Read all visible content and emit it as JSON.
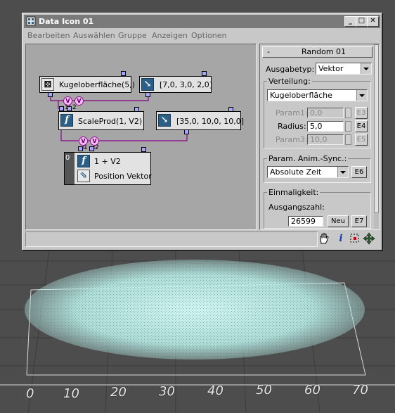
{
  "window": {
    "title": "Data Icon 01"
  },
  "menu": [
    "Bearbeiten",
    "Auswählen",
    "Gruppe",
    "Anzeigen",
    "Optionen"
  ],
  "nodes": {
    "kugel": {
      "label": "Kugeloberfläche(5,)"
    },
    "vec1": {
      "label": "[7,0, 3,0, 2,0]"
    },
    "scale": {
      "label": "ScaleProd(1, V2)"
    },
    "vec2": {
      "label": "[35,0, 10,0, 10,0]"
    },
    "out": {
      "label1": "1 + V2",
      "label2": "Position Vektor",
      "index": "0"
    },
    "ports": {
      "v": "V",
      "p1": "1",
      "p2": "2"
    }
  },
  "panel": {
    "rollout_collapse": "-",
    "rollout_title": "Random 01",
    "ausgabetyp_label": "Ausgabetyp:",
    "ausgabetyp_value": "Vektor",
    "verteilung_label": "Verteilung:",
    "verteilung_value": "Kugeloberfläche",
    "param1_label": "Param1:",
    "param1_value": "0,0",
    "param1_button": "E3",
    "radius_label": "Radius:",
    "radius_value": "5,0",
    "radius_button": "E4",
    "param3_label": "Param3:",
    "param3_value": "10,0",
    "param3_button": "E5",
    "sync_label": "Param. Anim.-Sync.:",
    "sync_value": "Absolute Zeit",
    "sync_button": "E6",
    "einmal_label": "Einmaligkeit:",
    "ausgang_label": "Ausgangszahl:",
    "ausgang_value": "26599",
    "neu_button": "Neu",
    "ausgang_button": "E7"
  },
  "axis": {
    "ticks": [
      "0",
      "10",
      "20",
      "30",
      "40",
      "50",
      "60",
      "70"
    ]
  },
  "colors": {
    "particles": "#c6fbf5",
    "node_icon": "#2b5f86",
    "port_circle": "#ffb6ff",
    "wire": "#8a1a8a",
    "pin": "#a6a6ff"
  },
  "icons": [
    "hand-icon",
    "info-icon",
    "select-region-icon",
    "move-icon",
    "dice-icon",
    "function-icon",
    "vector-icon"
  ]
}
